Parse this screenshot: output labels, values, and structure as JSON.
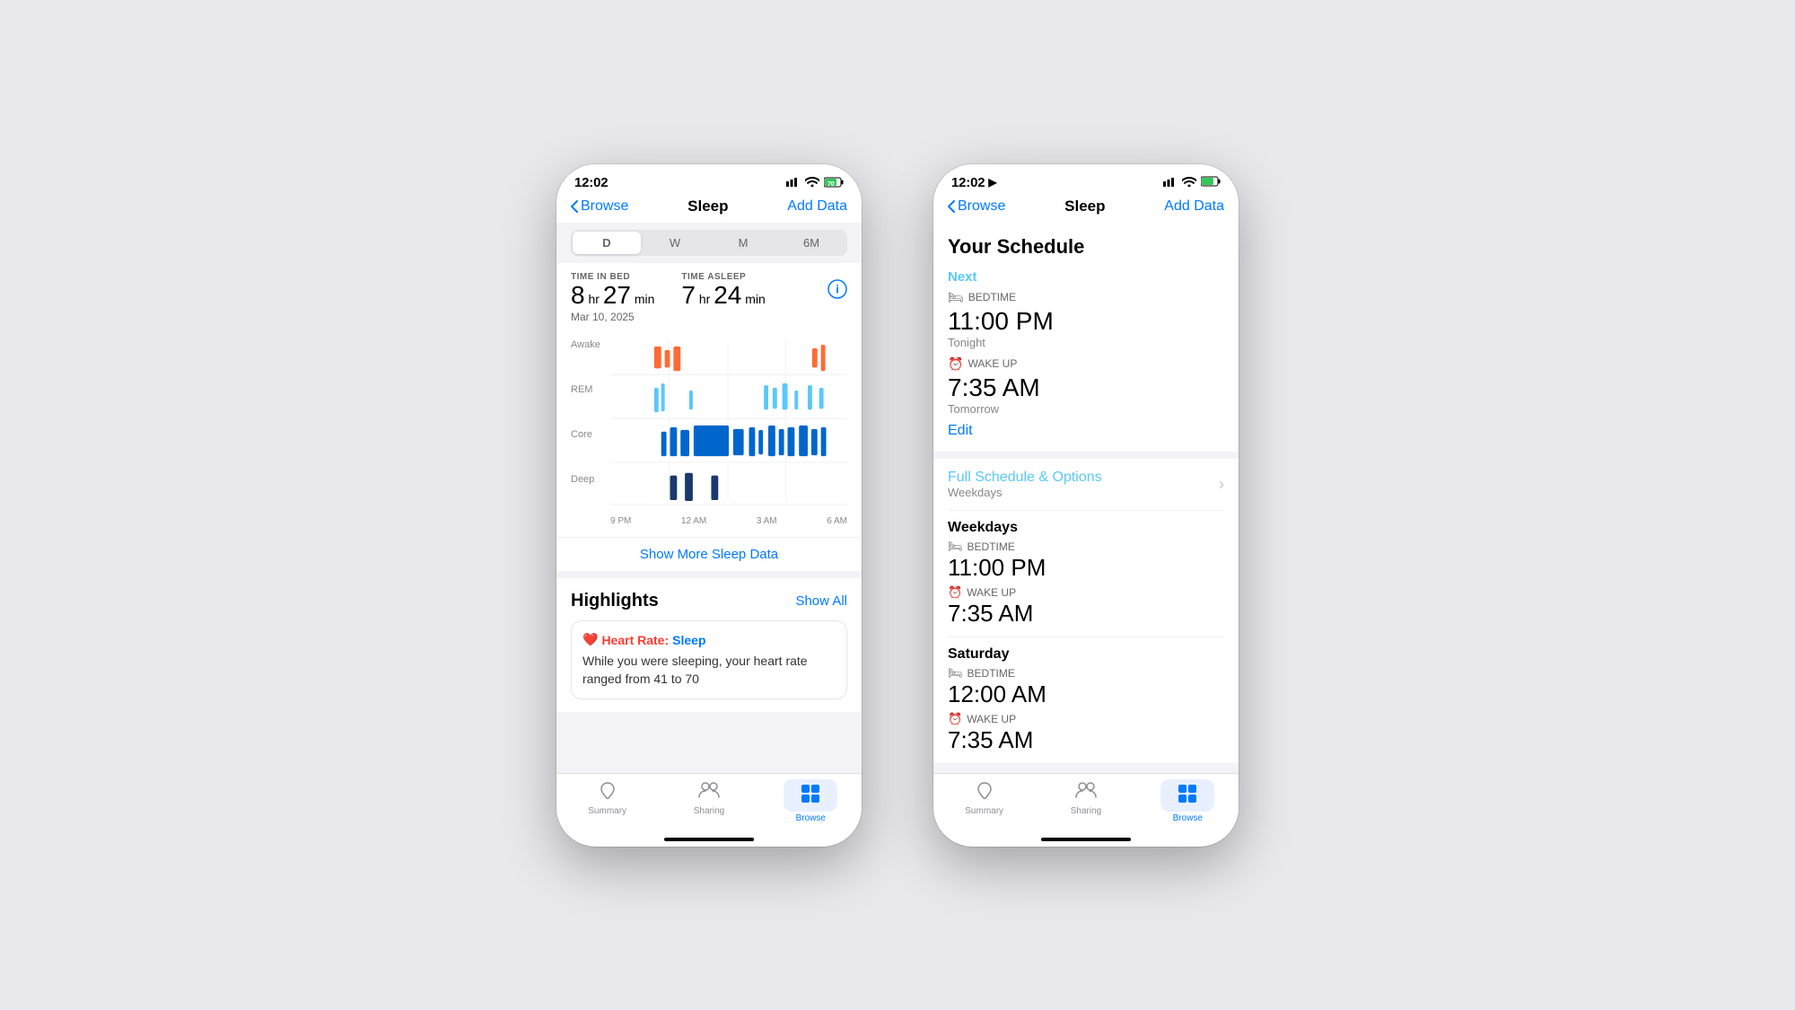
{
  "phone1": {
    "status_bar": {
      "time": "12:02",
      "signal": "▌▌▌",
      "wifi": "WiFi",
      "battery": "70"
    },
    "nav": {
      "back_label": "Browse",
      "title": "Sleep",
      "action": "Add Data"
    },
    "period_selector": {
      "options": [
        "D",
        "W",
        "M",
        "6M"
      ],
      "active": "D"
    },
    "stats": {
      "time_in_bed_label": "TIME IN BED",
      "time_in_bed_hr": "8",
      "time_in_bed_min": "27",
      "time_asleep_label": "TIME ASLEEP",
      "time_asleep_hr": "7",
      "time_asleep_min": "24",
      "date": "Mar 10, 2025"
    },
    "chart": {
      "labels": [
        "Awake",
        "REM",
        "Core",
        "Deep"
      ],
      "time_labels": [
        "9 PM",
        "12 AM",
        "3 AM",
        "6 AM"
      ]
    },
    "show_more": "Show More Sleep Data",
    "highlights": {
      "title": "Highlights",
      "show_all": "Show All",
      "card_title": "❤️ Heart Rate: Sleep",
      "card_text": "While you were sleeping, your heart rate ranged from 41 to 70"
    },
    "tab_bar": {
      "items": [
        {
          "label": "Summary",
          "icon": "♥",
          "active": false
        },
        {
          "label": "Sharing",
          "icon": "👥",
          "active": false
        },
        {
          "label": "Browse",
          "icon": "⊞",
          "active": true
        }
      ]
    }
  },
  "phone2": {
    "status_bar": {
      "time": "12:02",
      "location": "◀",
      "signal": "▌▌▌",
      "wifi": "WiFi",
      "battery": "70"
    },
    "nav": {
      "back_label": "Browse",
      "title": "Sleep",
      "action": "Add Data"
    },
    "schedule": {
      "title": "Your Schedule",
      "next_label": "Next",
      "bedtime_label": "BEDTIME",
      "next_bedtime": "11:00 PM",
      "tonight": "Tonight",
      "wakeup_label": "WAKE UP",
      "next_wakeup": "7:35 AM",
      "tomorrow": "Tomorrow",
      "edit_label": "Edit",
      "full_schedule_label": "Full Schedule & Options",
      "full_schedule_sub": "Weekdays",
      "weekday_bedtime_label": "BEDTIME",
      "weekday_bedtime": "11:00 PM",
      "weekday_wakeup_label": "WAKE UP",
      "weekday_wakeup": "7:35 AM",
      "saturday_label": "Saturday",
      "saturday_bedtime_label": "BEDTIME",
      "saturday_bedtime": "12:00 AM",
      "saturday_wakeup_label": "WAKE UP",
      "saturday_wakeup": "7:35 AM"
    },
    "tab_bar": {
      "items": [
        {
          "label": "Summary",
          "icon": "♥",
          "active": false
        },
        {
          "label": "Sharing",
          "icon": "👥",
          "active": false
        },
        {
          "label": "Browse",
          "icon": "⊞",
          "active": true
        }
      ]
    }
  }
}
